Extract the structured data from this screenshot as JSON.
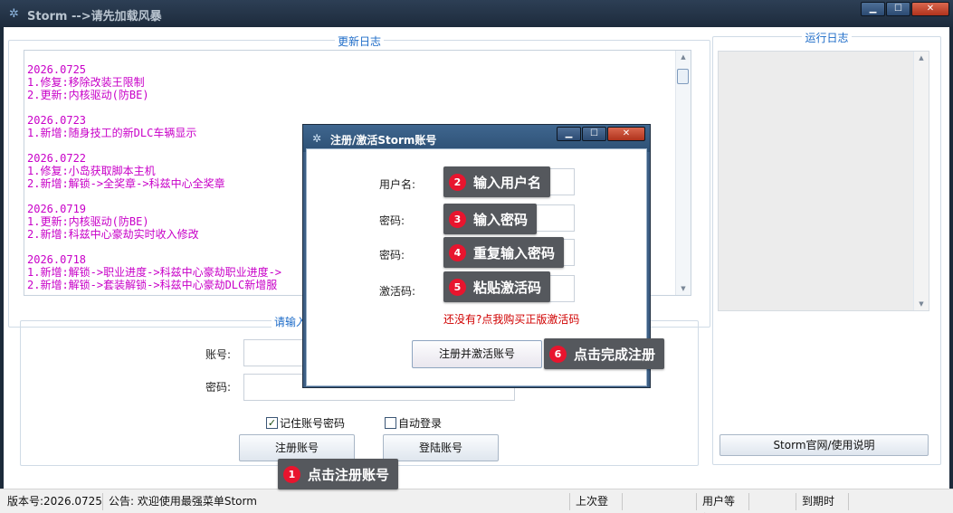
{
  "window": {
    "title": "Storm -->请先加载风暴",
    "app_icon": "storm-swirl-icon",
    "buttons": {
      "minimize": "▁",
      "maximize": "☐",
      "close": "✕"
    }
  },
  "update_log": {
    "title": "更新日志",
    "lines": [
      "2026.0725",
      "1.修复:移除改装王限制",
      "2.更新:内核驱动(防BE)",
      "",
      "2026.0723",
      "1.新增:随身技工的新DLC车辆显示",
      "",
      "2026.0722",
      "1.修复:小岛获取脚本主机",
      "2.新增:解锁->全奖章->科兹中心全奖章",
      "",
      "2026.0719",
      "1.更新:内核驱动(防BE)",
      "2.新增:科兹中心豪劫实时收入修改",
      "",
      "2026.0718",
      "1.新增:解锁->职业进度->科兹中心豪劫职业进度->",
      "2.新增:解锁->套装解锁->科兹中心豪劫DLC新增服"
    ]
  },
  "run_log": {
    "title": "运行日志"
  },
  "login": {
    "title": "请输入你的数",
    "account_label": "账号:",
    "password_label": "密码:",
    "remember_label": "记住账号密码",
    "remember_checked": true,
    "autologin_label": "自动登录",
    "autologin_checked": false,
    "register_button": "注册账号",
    "login_button": "登陆账号"
  },
  "official_button": "Storm官网/使用说明",
  "status": {
    "version": "版本号:2026.0725",
    "notice": "公告: 欢迎使用最强菜单Storm",
    "last_login": "上次登录:",
    "user_level": "用户等级:",
    "expire": "到期时间:"
  },
  "dialog": {
    "title": "注册/激活Storm账号",
    "username_label": "用户名:",
    "password_label": "密码:",
    "password2_label": "密码:",
    "code_label": "激活码:",
    "buy_tip": "还没有?点我购买正版激活码",
    "submit_button": "注册并激活账号"
  },
  "callouts": [
    {
      "num": "1",
      "text": "点击注册账号"
    },
    {
      "num": "2",
      "text": "输入用户名"
    },
    {
      "num": "3",
      "text": "输入密码"
    },
    {
      "num": "4",
      "text": "重复输入密码"
    },
    {
      "num": "5",
      "text": "粘贴激活码"
    },
    {
      "num": "6",
      "text": "点击完成注册"
    }
  ]
}
